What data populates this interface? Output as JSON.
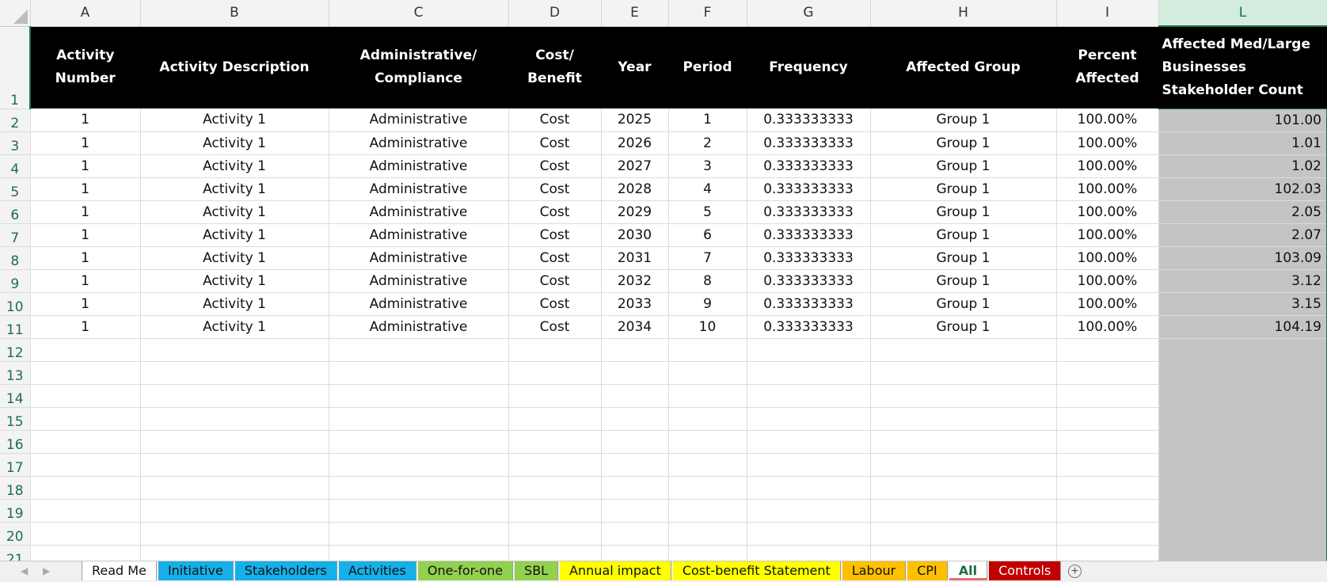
{
  "columns": [
    "A",
    "B",
    "C",
    "D",
    "E",
    "F",
    "G",
    "H",
    "I",
    "L"
  ],
  "header_labels": {
    "A": "Activity Number",
    "B": "Activity Description",
    "C": "Administrative/ Compliance",
    "D": "Cost/ Benefit",
    "E": "Year",
    "F": "Period",
    "G": "Frequency",
    "H": "Affected Group",
    "I": "Percent Affected",
    "L": "Affected Med/Large Businesses Stakeholder Count"
  },
  "rows": [
    {
      "n": "2",
      "cells": [
        "1",
        "Activity 1",
        "Administrative",
        "Cost",
        "2025",
        "1",
        "0.333333333",
        "Group 1",
        "100.00%",
        "101.00"
      ]
    },
    {
      "n": "3",
      "cells": [
        "1",
        "Activity 1",
        "Administrative",
        "Cost",
        "2026",
        "2",
        "0.333333333",
        "Group 1",
        "100.00%",
        "1.01"
      ]
    },
    {
      "n": "4",
      "cells": [
        "1",
        "Activity 1",
        "Administrative",
        "Cost",
        "2027",
        "3",
        "0.333333333",
        "Group 1",
        "100.00%",
        "1.02"
      ]
    },
    {
      "n": "5",
      "cells": [
        "1",
        "Activity 1",
        "Administrative",
        "Cost",
        "2028",
        "4",
        "0.333333333",
        "Group 1",
        "100.00%",
        "102.03"
      ]
    },
    {
      "n": "6",
      "cells": [
        "1",
        "Activity 1",
        "Administrative",
        "Cost",
        "2029",
        "5",
        "0.333333333",
        "Group 1",
        "100.00%",
        "2.05"
      ]
    },
    {
      "n": "7",
      "cells": [
        "1",
        "Activity 1",
        "Administrative",
        "Cost",
        "2030",
        "6",
        "0.333333333",
        "Group 1",
        "100.00%",
        "2.07"
      ]
    },
    {
      "n": "8",
      "cells": [
        "1",
        "Activity 1",
        "Administrative",
        "Cost",
        "2031",
        "7",
        "0.333333333",
        "Group 1",
        "100.00%",
        "103.09"
      ]
    },
    {
      "n": "9",
      "cells": [
        "1",
        "Activity 1",
        "Administrative",
        "Cost",
        "2032",
        "8",
        "0.333333333",
        "Group 1",
        "100.00%",
        "3.12"
      ]
    },
    {
      "n": "10",
      "cells": [
        "1",
        "Activity 1",
        "Administrative",
        "Cost",
        "2033",
        "9",
        "0.333333333",
        "Group 1",
        "100.00%",
        "3.15"
      ]
    },
    {
      "n": "11",
      "cells": [
        "1",
        "Activity 1",
        "Administrative",
        "Cost",
        "2034",
        "10",
        "0.333333333",
        "Group 1",
        "100.00%",
        "104.19"
      ]
    }
  ],
  "empty_row_numbers": [
    "12",
    "13",
    "14",
    "15",
    "16",
    "17",
    "18",
    "19",
    "20",
    "21"
  ],
  "sheet_tabs": [
    {
      "label": "Read Me",
      "style": "active"
    },
    {
      "label": "Initiative",
      "style": "blue"
    },
    {
      "label": "Stakeholders",
      "style": "blue"
    },
    {
      "label": "Activities",
      "style": "blue"
    },
    {
      "label": "One-for-one",
      "style": "green"
    },
    {
      "label": "SBL",
      "style": "green"
    },
    {
      "label": "Annual impact",
      "style": "yellow"
    },
    {
      "label": "Cost-benefit Statement",
      "style": "yellow"
    },
    {
      "label": "Labour",
      "style": "orange"
    },
    {
      "label": "CPI",
      "style": "orange"
    },
    {
      "label": "All",
      "style": "allsel"
    },
    {
      "label": "Controls",
      "style": "red"
    }
  ],
  "icons": {
    "scroll_left": "◀",
    "scroll_right": "▶",
    "add_sheet": "+"
  },
  "colors": {
    "header_bg": "#000000",
    "selection_green": "#217346",
    "selected_column_fill": "#c4c4c4"
  }
}
